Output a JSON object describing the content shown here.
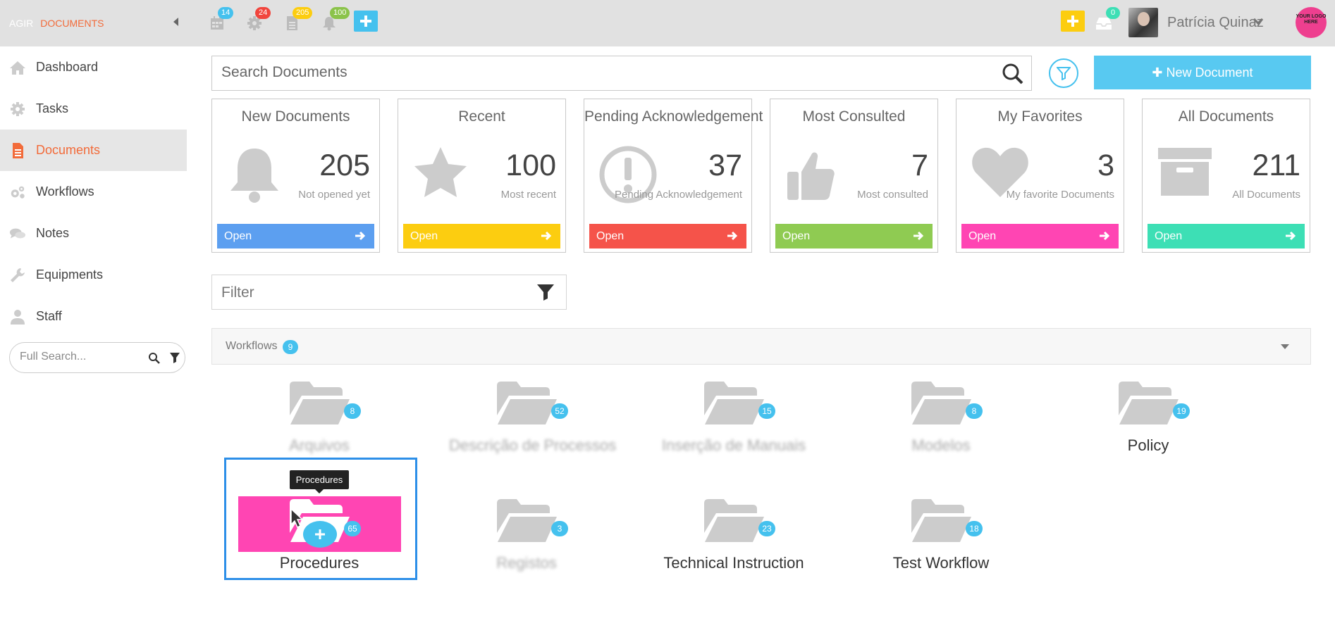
{
  "app": {
    "brand_prefix": "AGIR",
    "brand_section": "DOCUMENTS"
  },
  "topbar": {
    "badges": [
      {
        "icon": "calendar-icon",
        "count": "14",
        "color": "#45c1ee"
      },
      {
        "icon": "gear-icon",
        "count": "24",
        "color": "#f1453d"
      },
      {
        "icon": "document-icon",
        "count": "205",
        "color": "#fccd10"
      },
      {
        "icon": "bell-icon",
        "count": "100",
        "color": "#8bc34a"
      }
    ],
    "inbox_count": "0",
    "user_name": "Patrícia Quinaz",
    "logo_text": "YOUR LOGO HERE"
  },
  "sidebar": {
    "items": [
      {
        "label": "Dashboard",
        "icon": "home-icon"
      },
      {
        "label": "Tasks",
        "icon": "gear-icon"
      },
      {
        "label": "Documents",
        "icon": "document-icon",
        "active": true
      },
      {
        "label": "Workflows",
        "icon": "gears-icon"
      },
      {
        "label": "Notes",
        "icon": "comments-icon"
      },
      {
        "label": "Equipments",
        "icon": "wrench-icon"
      },
      {
        "label": "Staff",
        "icon": "user-icon"
      }
    ],
    "search_placeholder": "Full Search..."
  },
  "search": {
    "placeholder": "Search Documents"
  },
  "new_document_label": "New Document",
  "cards": [
    {
      "title": "New Documents",
      "count": "205",
      "subtitle": "Not opened yet",
      "button": "Open",
      "color": "#5c9ff0",
      "icon": "bell-icon"
    },
    {
      "title": "Recent",
      "count": "100",
      "subtitle": "Most recent",
      "button": "Open",
      "color": "#fccd10",
      "icon": "star-icon"
    },
    {
      "title": "Pending Acknowledgement",
      "count": "37",
      "subtitle": "Pending Acknowledgement",
      "button": "Open",
      "color": "#f5534a",
      "icon": "exclamation-circle-icon"
    },
    {
      "title": "Most Consulted",
      "count": "7",
      "subtitle": "Most consulted",
      "button": "Open",
      "color": "#8fcb52",
      "icon": "thumbs-up-icon"
    },
    {
      "title": "My Favorites",
      "count": "3",
      "subtitle": "My favorite Documents",
      "button": "Open",
      "color": "#ff45b3",
      "icon": "heart-icon"
    },
    {
      "title": "All Documents",
      "count": "211",
      "subtitle": "All Documents",
      "button": "Open",
      "color": "#3ddfb5",
      "icon": "archive-icon"
    }
  ],
  "filter": {
    "placeholder": "Filter"
  },
  "workflows": {
    "label": "Workflows",
    "count": "9",
    "folders": [
      {
        "name": "Arquivos",
        "count": "8"
      },
      {
        "name": "Descrição de Processos",
        "count": "52"
      },
      {
        "name": "Inserção de Manuais",
        "count": "15"
      },
      {
        "name": "Modelos",
        "count": "8"
      },
      {
        "name": "Policy",
        "count": "19"
      },
      {
        "name": "Procedures",
        "count": "65"
      },
      {
        "name": "Registos",
        "count": "3"
      },
      {
        "name": "Technical Instruction",
        "count": "23"
      },
      {
        "name": "Test Workflow",
        "count": "18"
      }
    ],
    "tooltip": "Procedures"
  }
}
